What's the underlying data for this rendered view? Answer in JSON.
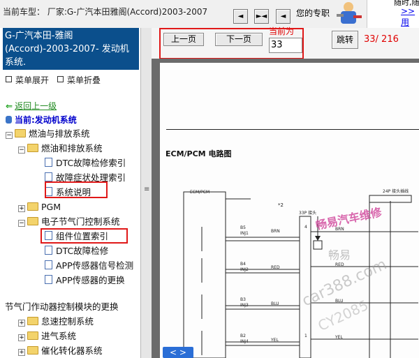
{
  "topbar": {
    "vehicle_label": "当前车型：  厂家:G-广汽本田雅阁(Accord)2003-2007",
    "nav_prev": "◄",
    "nav_split": "►◄",
    "nav_next": "◄",
    "promo": "您的专职",
    "ad_line1": "随时,随",
    "ad_link": ">>用"
  },
  "sidebar": {
    "title": "G-广汽本田-雅阁(Accord)-2003-2007- 发动机系统.",
    "expand_all": "菜单展开",
    "collapse_all": "菜单折叠",
    "back": "返回上一级",
    "current": "当前:发动机系统",
    "tree": [
      {
        "label": "燃油与排放系统",
        "kind": "folder",
        "pm": "-"
      },
      {
        "label": "燃油和排放系统",
        "kind": "folder",
        "pm": "-"
      },
      {
        "label": "DTC故障检修索引",
        "kind": "doc"
      },
      {
        "label": "故障症状处理索引",
        "kind": "doc"
      },
      {
        "label": "系统说明",
        "kind": "doc"
      },
      {
        "label": "PGM",
        "kind": "folder",
        "pm": "+"
      },
      {
        "label": "电子节气门控制系统",
        "kind": "folder",
        "pm": "-"
      },
      {
        "label": "组件位置索引",
        "kind": "doc"
      },
      {
        "label": "DTC故障检修",
        "kind": "doc"
      },
      {
        "label": "APP传感器信号检测",
        "kind": "doc"
      },
      {
        "label": "APP传感器的更换",
        "kind": "doc"
      },
      {
        "label": "节气门作动器控制模块的更换",
        "kind": "text"
      },
      {
        "label": "怠速控制系统",
        "kind": "folder",
        "pm": "+"
      },
      {
        "label": "进气系统",
        "kind": "folder",
        "pm": "+"
      },
      {
        "label": "催化转化器系统",
        "kind": "folder",
        "pm": "+"
      }
    ]
  },
  "toolbar": {
    "prev_label": "上一页",
    "next_label": "下一页",
    "current_label": "当前为",
    "page_value": "33",
    "jump_label": "跳转",
    "page_info": "33/ 216"
  },
  "document": {
    "title": "ECM/PCM 电路图",
    "ecm_label": "ECM/PCM",
    "connector_label": "24P 接头插线",
    "connector2_label": "33P 接头",
    "note": "*2",
    "pins": [
      {
        "id": "B5",
        "name": "INJ1",
        "wire": "BRN",
        "num": "4"
      },
      {
        "id": "B4",
        "name": "INJ2",
        "wire": "RED",
        "num": ""
      },
      {
        "id": "B3",
        "name": "INJ3",
        "wire": "BLU",
        "num": ""
      },
      {
        "id": "B2",
        "name": "INJ4",
        "wire": "YEL",
        "num": "1"
      }
    ],
    "watermarks": [
      "畅易汽车维修",
      "畅易",
      "car388.com",
      "CY2085"
    ]
  },
  "viewer_nav": "< >"
}
